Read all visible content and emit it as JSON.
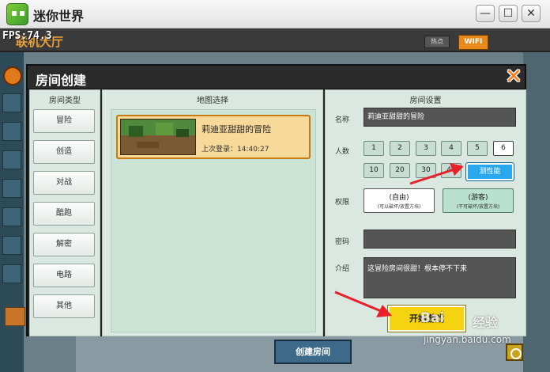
{
  "window": {
    "title": "迷你世界",
    "min_glyph": "—",
    "max_glyph": "☐",
    "close_glyph": "✕"
  },
  "game": {
    "fps": "FPS:74.3",
    "lobby_title": "联机大厅",
    "tab_hot": "热点",
    "tab_wifi": "WIFI",
    "create_room": "创建房间"
  },
  "dialog": {
    "title": "房间创建",
    "close_glyph": "✕",
    "room_type": {
      "label": "房间类型",
      "items": [
        {
          "label": "冒险"
        },
        {
          "label": "创造"
        },
        {
          "label": "对战"
        },
        {
          "label": "酷跑"
        },
        {
          "label": "解密"
        },
        {
          "label": "电路"
        },
        {
          "label": "其他"
        }
      ]
    },
    "map_select": {
      "label": "地图选择",
      "maps": [
        {
          "name": "莉迪亚甜甜的冒险",
          "last_login": "上次登录：14:40:27"
        }
      ]
    },
    "settings": {
      "label": "房间设置",
      "name_label": "名称",
      "name_value": "莉迪亚甜甜的冒险",
      "players_label": "人数",
      "player_options": [
        "1",
        "2",
        "3",
        "4",
        "5",
        "6",
        "10",
        "20",
        "30",
        "40"
      ],
      "performance_label": "测性能",
      "permission_label": "权限",
      "permission_free": {
        "main": "(自由)",
        "sub": "(可以破坏/放置方块)"
      },
      "permission_guest": {
        "main": "(游客)",
        "sub": "(不可破坏/放置方块)"
      },
      "password_label": "密码",
      "intro_label": "介绍",
      "intro_value": "这冒险房间很甜！根本停不下来",
      "start_button": "开始游戏"
    }
  },
  "watermark": {
    "logo": "Bai",
    "cn": "经验",
    "url": "jingyan.baidu.com"
  },
  "colors": {
    "accent_orange": "#e88a1a",
    "start_yellow": "#f6d310",
    "selected_blue": "#29a7ef",
    "arrow_red": "#e8202a"
  }
}
